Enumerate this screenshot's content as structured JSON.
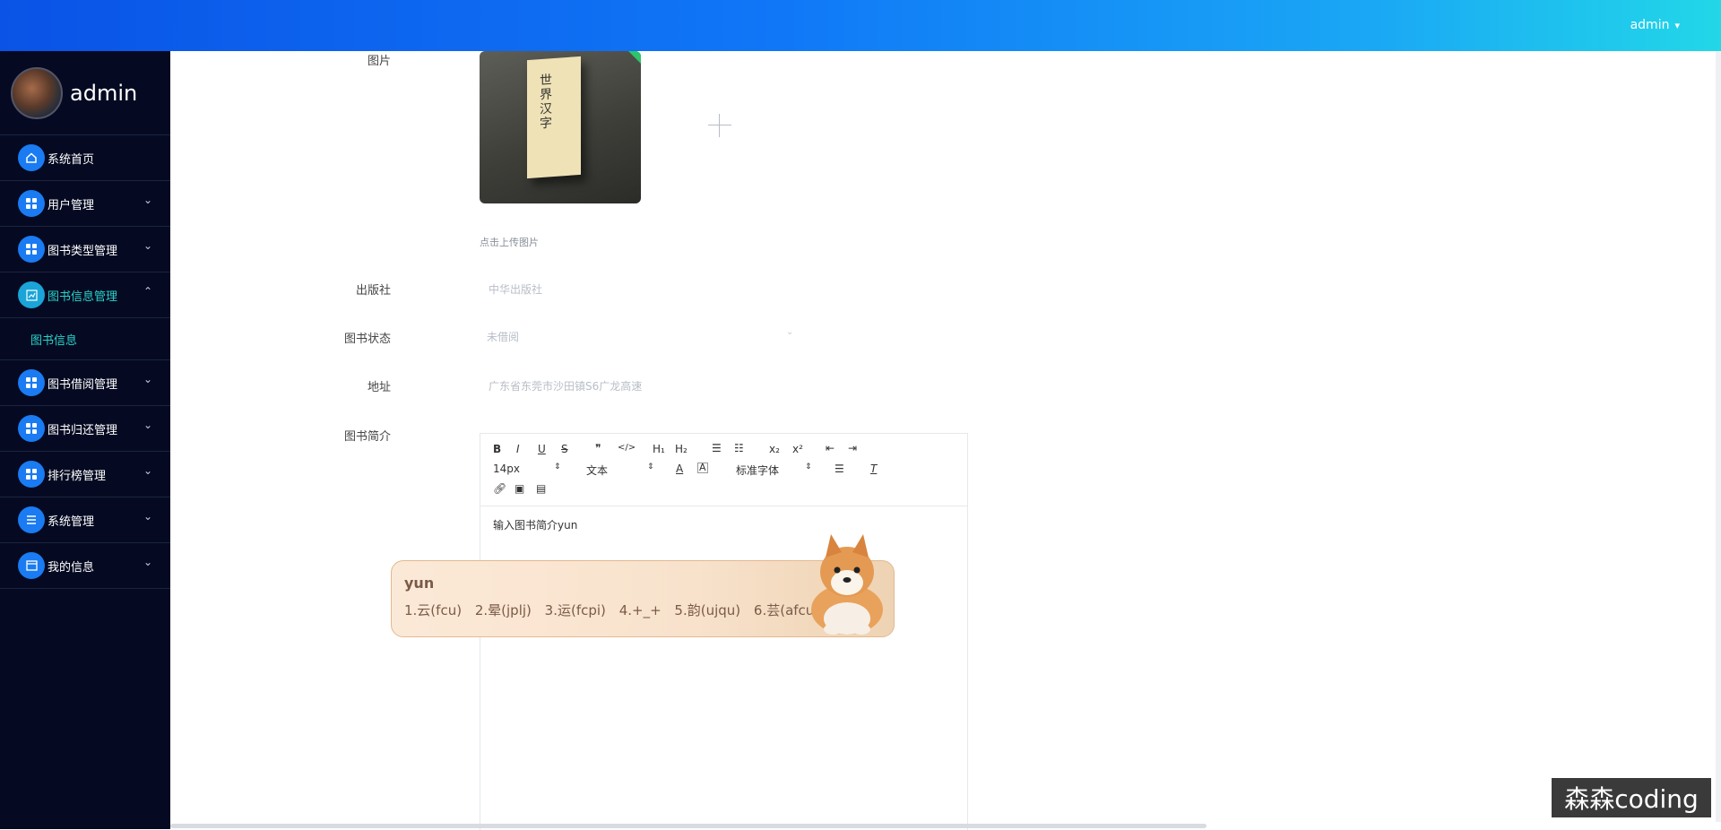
{
  "topbar": {
    "user": "admin",
    "caret": "▾"
  },
  "sidebar": {
    "brand": "admin",
    "items": [
      {
        "label": "系统首页",
        "icon": "home-icon",
        "chevron": ""
      },
      {
        "label": "用户管理",
        "icon": "grid-icon",
        "chevron": "⌄"
      },
      {
        "label": "图书类型管理",
        "icon": "grid-icon",
        "chevron": "⌄"
      },
      {
        "label": "图书信息管理",
        "icon": "chart-icon",
        "chevron": "⌃",
        "active": true
      },
      {
        "label": "图书借阅管理",
        "icon": "grid-icon",
        "chevron": "⌄"
      },
      {
        "label": "图书归还管理",
        "icon": "grid-icon",
        "chevron": "⌄"
      },
      {
        "label": "排行榜管理",
        "icon": "grid-icon",
        "chevron": "⌄"
      },
      {
        "label": "系统管理",
        "icon": "list-icon",
        "chevron": "⌄"
      },
      {
        "label": "我的信息",
        "icon": "card-icon",
        "chevron": "⌄"
      }
    ],
    "sub_items": [
      {
        "label": "图书信息"
      }
    ]
  },
  "form": {
    "image_label": "图片",
    "upload_hint": "点击上传图片",
    "publisher_label": "出版社",
    "publisher_value": "中华出版社",
    "status_label": "图书状态",
    "status_value": "未借阅",
    "address_label": "地址",
    "address_value": "广东省东莞市沙田镇S6广龙高速",
    "intro_label": "图书简介",
    "book_cover_text": "世界汉字"
  },
  "editor": {
    "toolbar_row1": [
      "B",
      "I",
      "U",
      "S",
      "❞",
      "</>",
      "H₁",
      "H₂",
      "☰",
      "☷",
      "x₂",
      "x²",
      "⇤",
      "⇥"
    ],
    "font_size": "14px",
    "block_type": "文本",
    "font_family": "标准字体",
    "content": "输入图书简介yun"
  },
  "ime": {
    "composition": "yun",
    "candidates": [
      "1.云(fcu)",
      "2.晕(jplj)",
      "3.运(fcpi)",
      "4.+_+",
      "5.韵(ujqu)",
      "6.芸(afcu)"
    ]
  },
  "watermark": "森森coding",
  "colors": {
    "sidebar_bg": "#050a22",
    "accent": "#2ad2c9",
    "icon_bg": "#1a7bf2"
  }
}
